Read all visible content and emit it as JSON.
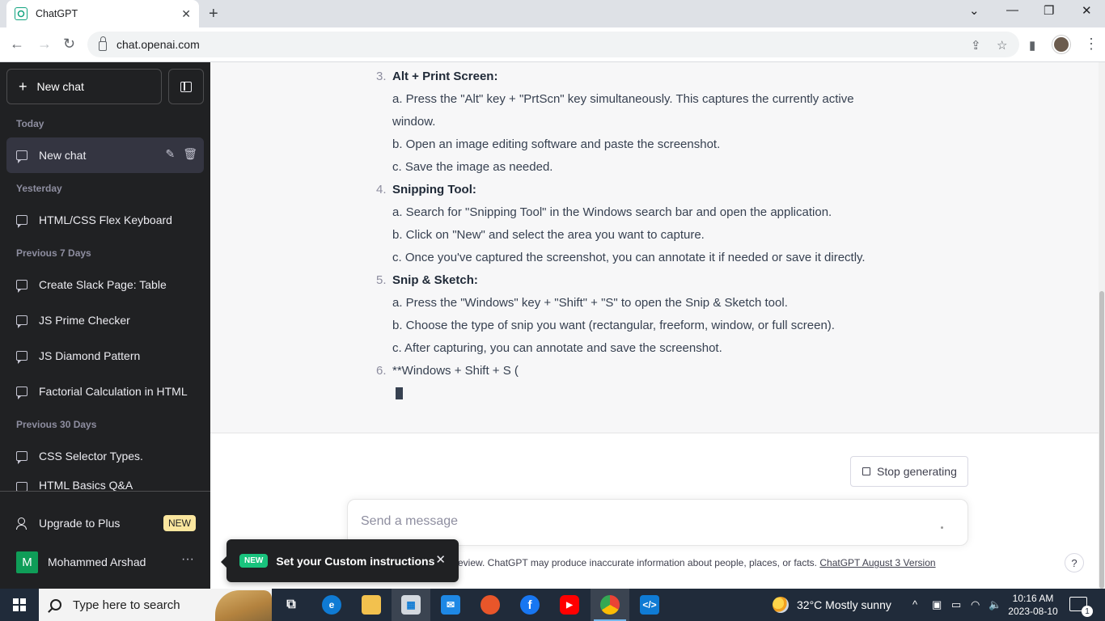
{
  "browser": {
    "tab_title": "ChatGPT",
    "url": "chat.openai.com"
  },
  "sidebar": {
    "new_chat": "New chat",
    "sections": [
      {
        "label": "Today",
        "items": [
          "New chat"
        ]
      },
      {
        "label": "Yesterday",
        "items": [
          "HTML/CSS Flex Keyboard"
        ]
      },
      {
        "label": "Previous 7 Days",
        "items": [
          "Create Slack Page: Table",
          "JS Prime Checker",
          "JS Diamond Pattern",
          "Factorial Calculation in HTML"
        ]
      },
      {
        "label": "Previous 30 Days",
        "items": [
          "CSS Selector Types.",
          "HTML Basics Q&A"
        ]
      }
    ],
    "upgrade": "Upgrade to Plus",
    "upgrade_badge": "NEW",
    "user_initial": "M",
    "user_name": "Mohammed Arshad"
  },
  "answer": {
    "steps": [
      {
        "num": "3.",
        "title": "Alt + Print Screen:",
        "lines": [
          "a. Press the \"Alt\" key + \"PrtScn\" key simultaneously. This captures the currently active",
          "window.",
          "b. Open an image editing software and paste the screenshot.",
          "c. Save the image as needed."
        ]
      },
      {
        "num": "4.",
        "title": "Snipping Tool:",
        "lines": [
          "a. Search for \"Snipping Tool\" in the Windows search bar and open the application.",
          "b. Click on \"New\" and select the area you want to capture.",
          "c. Once you've captured the screenshot, you can annotate it if needed or save it directly."
        ]
      },
      {
        "num": "5.",
        "title": "Snip & Sketch:",
        "lines": [
          "a. Press the \"Windows\" key + \"Shift\" + \"S\" to open the Snip & Sketch tool.",
          "b. Choose the type of snip you want (rectangular, freeform, window, or full screen).",
          "c. After capturing, you can annotate and save the screenshot."
        ]
      },
      {
        "num": "6.",
        "title": "",
        "lines": [
          "**Windows + Shift + S ("
        ]
      }
    ]
  },
  "composer": {
    "stop_label": "Stop generating",
    "placeholder": "Send a message",
    "disclaimer": "eview. ChatGPT may produce inaccurate information about people, places, or facts.",
    "version_link": "ChatGPT August 3 Version",
    "help": "?"
  },
  "toast": {
    "tag": "NEW",
    "text": "Set your Custom instructions"
  },
  "taskbar": {
    "search_placeholder": "Type here to search",
    "weather": "32°C  Mostly sunny",
    "time": "10:16 AM",
    "date": "2023-08-10",
    "notifications": "1"
  }
}
